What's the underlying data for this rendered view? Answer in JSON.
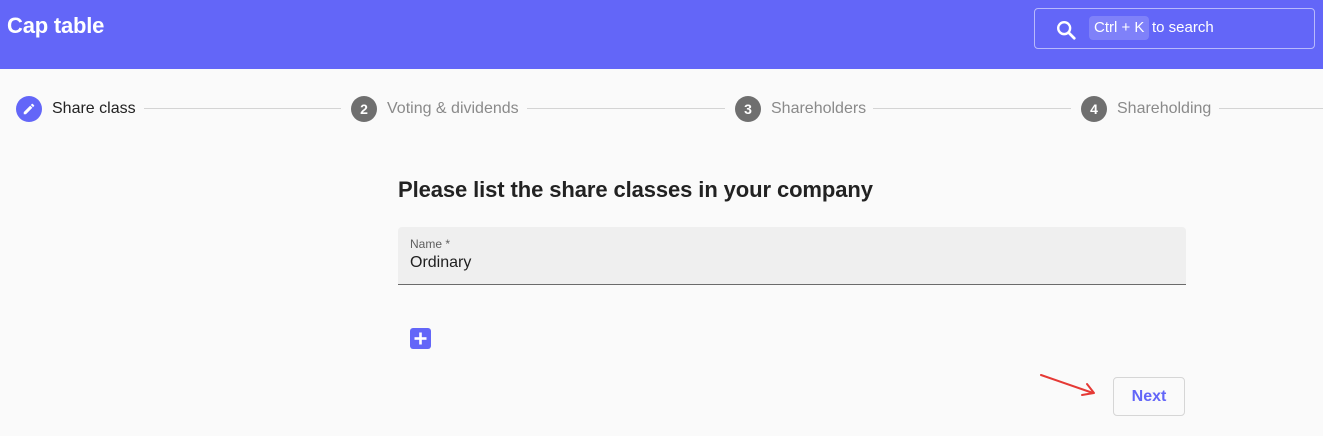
{
  "app": {
    "title": "Cap table",
    "brand_color": "#6366f8"
  },
  "search": {
    "shortcut": "Ctrl + K",
    "hint": "to search",
    "icon": "search-icon"
  },
  "stepper": {
    "steps": [
      {
        "number": "1",
        "label": "Share class",
        "state": "active",
        "icon": "pencil-icon"
      },
      {
        "number": "2",
        "label": "Voting & dividends",
        "state": "inactive"
      },
      {
        "number": "3",
        "label": "Shareholders",
        "state": "inactive"
      },
      {
        "number": "4",
        "label": "Shareholding",
        "state": "inactive"
      }
    ]
  },
  "form": {
    "heading": "Please list the share classes in your company",
    "name_field": {
      "label": "Name *",
      "value": "Ordinary"
    },
    "add_button_icon": "plus-icon"
  },
  "actions": {
    "next_label": "Next"
  }
}
